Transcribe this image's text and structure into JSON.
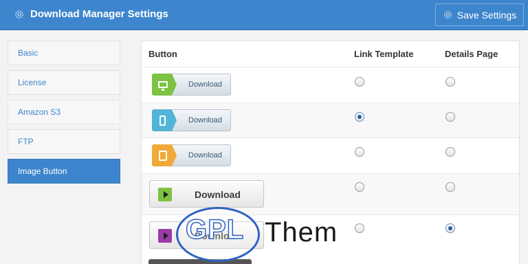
{
  "header": {
    "title": "Download Manager Settings",
    "save_label": "Save Settings",
    "title_icon": "gear-icon",
    "save_icon": "gear-icon"
  },
  "sidebar": {
    "items": [
      {
        "label": "Basic",
        "active": false
      },
      {
        "label": "License",
        "active": false
      },
      {
        "label": "Amazon S3",
        "active": false
      },
      {
        "label": "FTP",
        "active": false
      },
      {
        "label": "Image Button",
        "active": true
      }
    ]
  },
  "table": {
    "columns": [
      "Button",
      "Link Template",
      "Details Page"
    ],
    "rows": [
      {
        "button_text": "Download",
        "style": "green-monitor",
        "link_template": false,
        "details_page": false
      },
      {
        "button_text": "Download",
        "style": "blue-phone",
        "link_template": true,
        "details_page": false
      },
      {
        "button_text": "Download",
        "style": "orange-tablet",
        "link_template": false,
        "details_page": false
      },
      {
        "button_text": "Download",
        "style": "green-play",
        "link_template": false,
        "details_page": false
      },
      {
        "button_text": "Downloa",
        "style": "purple-play",
        "link_template": false,
        "details_page": true
      }
    ]
  },
  "colors": {
    "accent": "#3d86cd",
    "green": "#7dc242",
    "blue": "#52b4d6",
    "orange": "#f1a93a",
    "purple": "#9b3aa8"
  },
  "watermark": {
    "left": "GPL",
    "right": "Them"
  }
}
